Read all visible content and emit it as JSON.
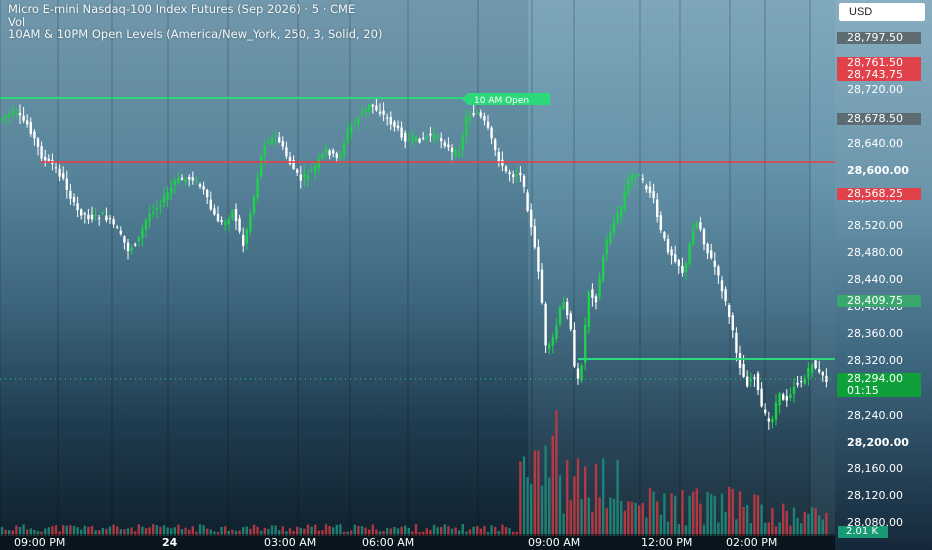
{
  "legend": {
    "title": "Micro E-mini Nasdaq-100 Index Futures (Sep 2026) · 5 · CME",
    "vol_label": "Vol",
    "indicator": "10AM & 10PM Open Levels (America/New_York, 250, 3, Solid, 20)"
  },
  "currency": "USD",
  "price_axis": {
    "labels": [
      "28,720.00",
      "28,640.00",
      "28,600.00",
      "28,560.00",
      "28,520.00",
      "28,480.00",
      "28,440.00",
      "28,400.00",
      "28,360.00",
      "28,320.00",
      "28,240.00",
      "28,200.00",
      "28,160.00",
      "28,120.00",
      "28,080.00"
    ],
    "badges": [
      {
        "text": "28,797.50",
        "bg": "#5d6b73"
      },
      {
        "text": "28,761.50",
        "bg": "#e0414a"
      },
      {
        "text": "28,743.75",
        "bg": "#e0414a"
      },
      {
        "text": "28,678.50",
        "bg": "#5d6b73"
      },
      {
        "text": "28,568.25",
        "bg": "#e0414a"
      },
      {
        "text": "28,409.75",
        "bg": "#3aa86e"
      },
      {
        "text": "28,294.00",
        "bg": "#0fa03c"
      },
      {
        "text": "01:15",
        "bg": "#0fa03c"
      }
    ],
    "volume_badge": "2.01 K"
  },
  "annotations": {
    "open_label": "10 AM Open"
  },
  "time_axis": [
    "09:00 PM",
    "24",
    "03:00 AM",
    "06:00 AM",
    "09:00 AM",
    "12:00 PM",
    "02:00 PM"
  ],
  "colors": {
    "up": "#1fd14a",
    "down": "#ffffff",
    "green_line": "#2bd97a",
    "red_line": "#ef3b46",
    "vol_up": "#1f8a7a",
    "vol_down": "#c23a44"
  }
}
